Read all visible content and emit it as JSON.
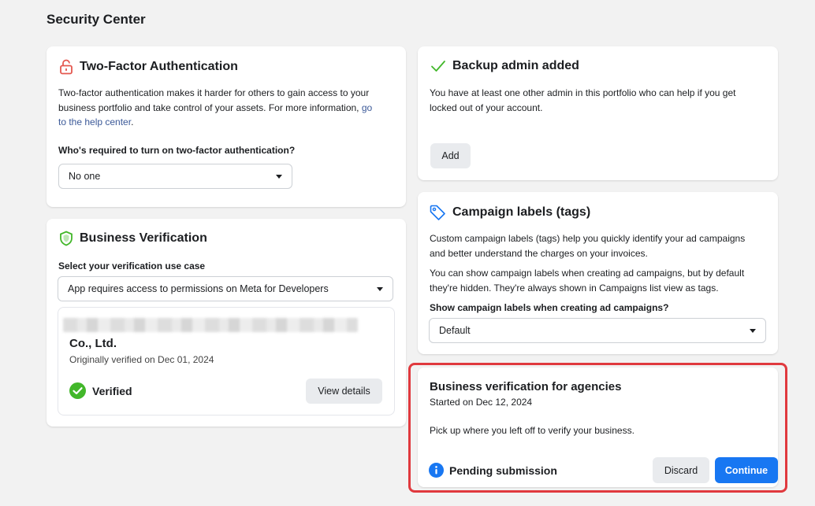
{
  "page": {
    "title": "Security Center"
  },
  "two_factor": {
    "title": "Two-Factor Authentication",
    "description_line1": "Two-factor authentication makes it harder for others to gain access to your",
    "description_line2": "business portfolio and take control of your assets. For more information,",
    "link_part1": "go",
    "link_part2": "to the help center",
    "description_end": ".",
    "question": "Who's required to turn on two-factor authentication?",
    "select_value": "No one"
  },
  "backup_admin": {
    "title": "Backup admin added",
    "description_line1": "You have at least one other admin in this portfolio who can help if you get",
    "description_line2": "locked out of your account.",
    "add_label": "Add"
  },
  "business_verification": {
    "title": "Business Verification",
    "select_label": "Select your verification use case",
    "select_value": "App requires access to permissions on Meta for Developers",
    "company_name": "Co., Ltd.",
    "verified_date": "Originally verified on Dec 01, 2024",
    "status": "Verified",
    "view_details_label": "View details"
  },
  "campaign_labels": {
    "title": "Campaign labels (tags)",
    "para1_line1": "Custom campaign labels (tags) help you quickly identify your ad campaigns",
    "para1_line2": "and better understand the charges on your invoices.",
    "para2_line1": "You can show campaign labels when creating ad campaigns, but by default",
    "para2_line2": "they're hidden. They're always shown in Campaigns list view as tags.",
    "question": "Show campaign labels when creating ad campaigns?",
    "select_value": "Default"
  },
  "agency_verification": {
    "title": "Business verification for agencies",
    "started": "Started on Dec 12, 2024",
    "description": "Pick up where you left off to verify your business.",
    "status": "Pending submission",
    "discard_label": "Discard",
    "continue_label": "Continue"
  },
  "colors": {
    "accent": "#1877f2",
    "highlight_border": "#e0393e",
    "verified_green": "#42b72a",
    "lock_red": "#e4574f",
    "link": "#3b5998"
  },
  "icons": {
    "two_factor": "lock-open-icon",
    "backup_admin": "checkmark-icon",
    "business_verification": "shield-icon",
    "campaign_labels": "tag-icon",
    "verified": "check-circle-icon",
    "pending": "info-circle-icon"
  }
}
